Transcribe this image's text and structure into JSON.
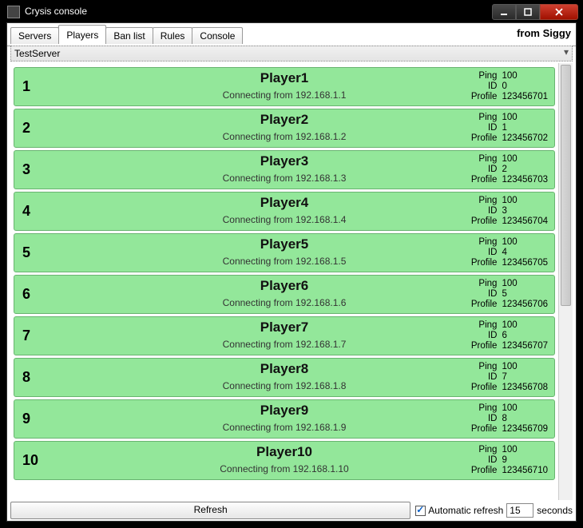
{
  "window": {
    "title": "Crysis console"
  },
  "tabs": [
    {
      "label": "Servers"
    },
    {
      "label": "Players"
    },
    {
      "label": "Ban list"
    },
    {
      "label": "Rules"
    },
    {
      "label": "Console"
    }
  ],
  "from_label": "from Siggy",
  "dropdown": {
    "value": "TestServer"
  },
  "connect_prefix": "Connecting from ",
  "stat_labels": {
    "ping": "Ping",
    "id": "ID",
    "profile": "Profile"
  },
  "players": [
    {
      "rank": "1",
      "name": "Player1",
      "ip": "192.168.1.1",
      "ping": "100",
      "id": "0",
      "profile": "123456701"
    },
    {
      "rank": "2",
      "name": "Player2",
      "ip": "192.168.1.2",
      "ping": "100",
      "id": "1",
      "profile": "123456702"
    },
    {
      "rank": "3",
      "name": "Player3",
      "ip": "192.168.1.3",
      "ping": "100",
      "id": "2",
      "profile": "123456703"
    },
    {
      "rank": "4",
      "name": "Player4",
      "ip": "192.168.1.4",
      "ping": "100",
      "id": "3",
      "profile": "123456704"
    },
    {
      "rank": "5",
      "name": "Player5",
      "ip": "192.168.1.5",
      "ping": "100",
      "id": "4",
      "profile": "123456705"
    },
    {
      "rank": "6",
      "name": "Player6",
      "ip": "192.168.1.6",
      "ping": "100",
      "id": "5",
      "profile": "123456706"
    },
    {
      "rank": "7",
      "name": "Player7",
      "ip": "192.168.1.7",
      "ping": "100",
      "id": "6",
      "profile": "123456707"
    },
    {
      "rank": "8",
      "name": "Player8",
      "ip": "192.168.1.8",
      "ping": "100",
      "id": "7",
      "profile": "123456708"
    },
    {
      "rank": "9",
      "name": "Player9",
      "ip": "192.168.1.9",
      "ping": "100",
      "id": "8",
      "profile": "123456709"
    },
    {
      "rank": "10",
      "name": "Player10",
      "ip": "192.168.1.10",
      "ping": "100",
      "id": "9",
      "profile": "123456710"
    }
  ],
  "bottom": {
    "refresh_label": "Refresh",
    "auto_label": "Automatic refresh",
    "interval": "15",
    "seconds_label": "seconds"
  }
}
